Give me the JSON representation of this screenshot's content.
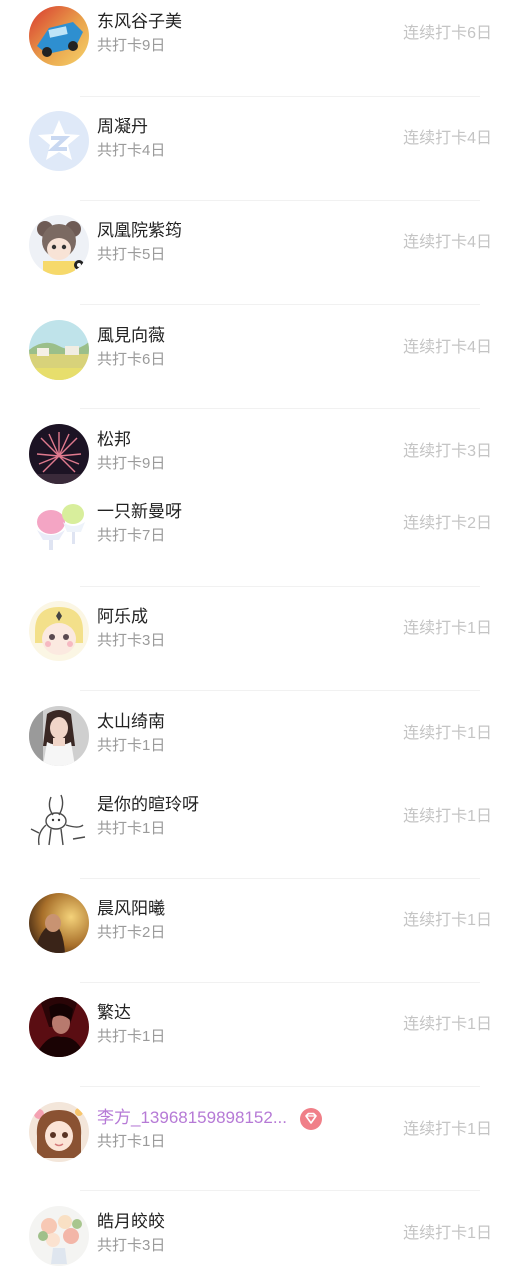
{
  "rows": [
    {
      "name": "东风谷子美",
      "total": "共打卡9日",
      "streak": "连续打卡6日",
      "avatar_icon": "blue-car-photo-icon"
    },
    {
      "name": "周凝丹",
      "total": "共打卡4日",
      "streak": "连续打卡4日",
      "avatar_icon": "default-star-avatar-icon"
    },
    {
      "name": "凤凰院紫筠",
      "total": "共打卡5日",
      "streak": "连续打卡4日",
      "avatar_icon": "bear-girl-illustration-icon"
    },
    {
      "name": "風見向薇",
      "total": "共打卡6日",
      "streak": "连续打卡4日",
      "avatar_icon": "landscape-painting-icon"
    },
    {
      "name": "松邦",
      "total": "共打卡9日",
      "streak": "连续打卡3日",
      "avatar_icon": "pink-firework-photo-icon"
    },
    {
      "name": "一只新曼呀",
      "total": "共打卡7日",
      "streak": "连续打卡2日",
      "avatar_icon": "shaved-ice-dessert-icon"
    },
    {
      "name": "阿乐成",
      "total": "共打卡3日",
      "streak": "连续打卡1日",
      "avatar_icon": "blonde-anime-girl-icon"
    },
    {
      "name": "太山绮南",
      "total": "共打卡1日",
      "streak": "连续打卡1日",
      "avatar_icon": "woman-portrait-photo-icon"
    },
    {
      "name": "是你的暄玲呀",
      "total": "共打卡1日",
      "streak": "连续打卡1日",
      "avatar_icon": "bunny-sketch-icon"
    },
    {
      "name": "晨风阳曦",
      "total": "共打卡2日",
      "streak": "连续打卡1日",
      "avatar_icon": "golden-light-photo-icon"
    },
    {
      "name": "繁达",
      "total": "共打卡1日",
      "streak": "连续打卡1日",
      "avatar_icon": "dark-red-portrait-icon"
    },
    {
      "name": "李方_13968159898152...",
      "total": "共打卡1日",
      "streak": "连续打卡1日",
      "avatar_icon": "brown-hair-anime-girl-icon",
      "vip": true,
      "vip_icon": "vip-diamond-icon"
    },
    {
      "name": "皓月皎皎",
      "total": "共打卡3日",
      "streak": "连续打卡1日",
      "avatar_icon": "flower-bouquet-photo-icon"
    }
  ],
  "colors": {
    "name_text": "#222222",
    "vip_name_text": "#b67ad6",
    "vip_badge": "#f07f88",
    "total_text": "#9a9a9a",
    "streak_text": "#c4c4c4",
    "divider": "#f1f1f1"
  }
}
